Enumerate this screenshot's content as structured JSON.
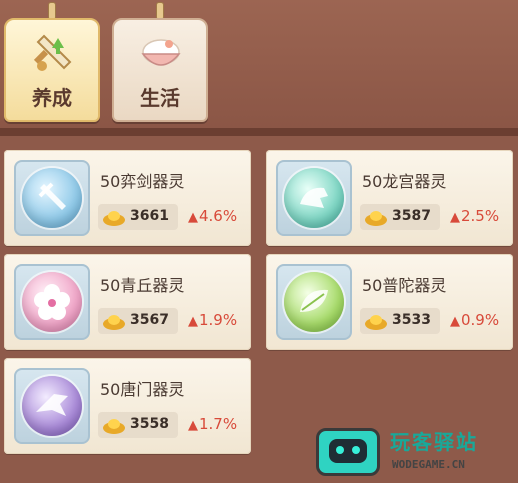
{
  "tabs": [
    {
      "label": "养成",
      "active": true,
      "icon": "sword-icon"
    },
    {
      "label": "生活",
      "active": false,
      "icon": "rice-bowl-icon"
    }
  ],
  "cards": [
    {
      "title": "50弈剑器灵",
      "value": "3661",
      "growth": "4.6%",
      "icon": "sword-orb-icon",
      "orb_color": "#8fc9e8"
    },
    {
      "title": "50龙宫器灵",
      "value": "3587",
      "growth": "2.5%",
      "icon": "dragon-orb-icon",
      "orb_color": "#7ed6c4"
    },
    {
      "title": "50青丘器灵",
      "value": "3567",
      "growth": "1.9%",
      "icon": "flower-orb-icon",
      "orb_color": "#f0a6c8"
    },
    {
      "title": "50普陀器灵",
      "value": "3533",
      "growth": "0.9%",
      "icon": "leaf-orb-icon",
      "orb_color": "#a7db6a"
    },
    {
      "title": "50唐门器灵",
      "value": "3558",
      "growth": "1.7%",
      "icon": "crossbow-orb-icon",
      "orb_color": "#a98ad8"
    }
  ],
  "watermark": {
    "cn": "玩客驿站",
    "en": "WODEGAME.CN"
  },
  "colors": {
    "background": "#8e5a4a",
    "growth": "#d84a3a",
    "card": "#fbf5ea"
  }
}
